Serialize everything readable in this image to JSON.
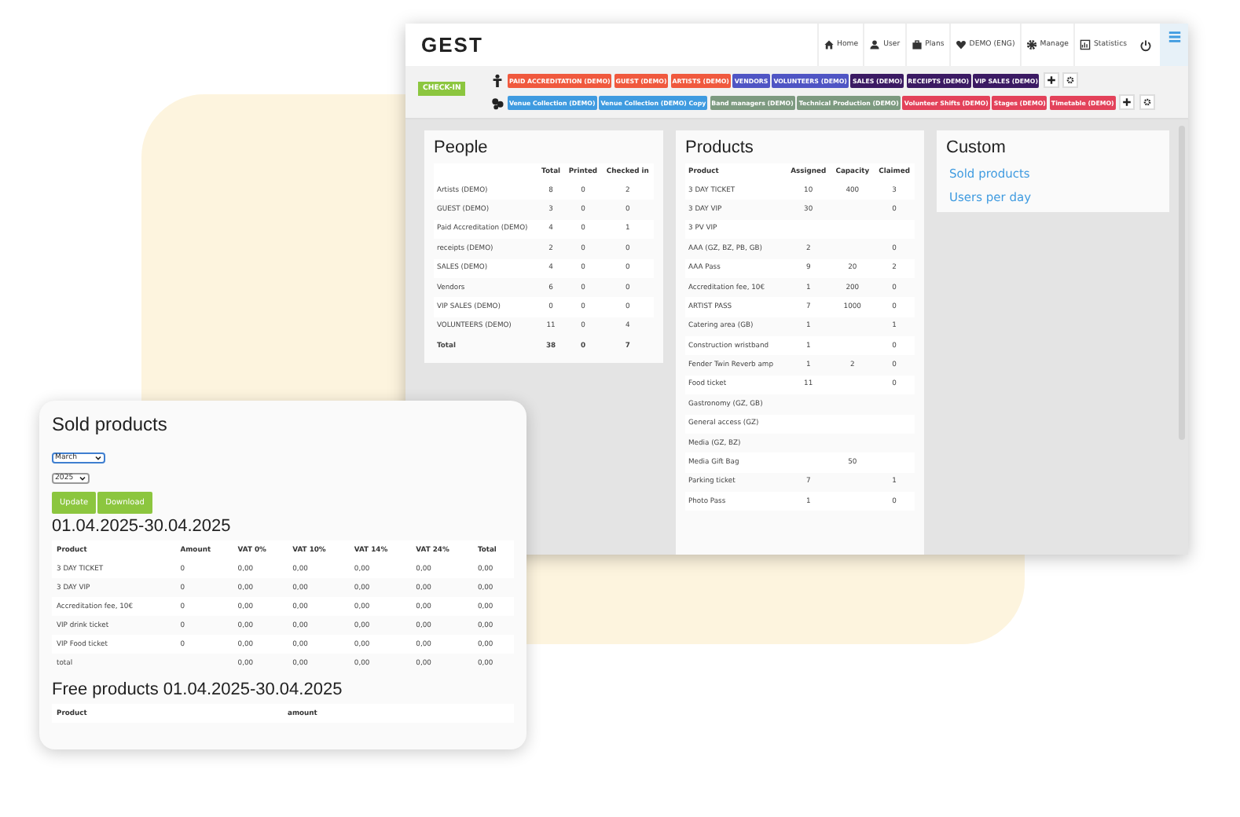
{
  "app": {
    "logo": "GEST",
    "nav": [
      {
        "label": "Home"
      },
      {
        "label": "User"
      },
      {
        "label": "Plans"
      },
      {
        "label": "DEMO (ENG)"
      },
      {
        "label": "Manage"
      },
      {
        "label": "Statistics"
      }
    ],
    "checkin": "CHECK-IN",
    "tag_rows": [
      {
        "tags": [
          {
            "label": "PAID ACCREDITATION (DEMO)",
            "color": "#f0593e"
          },
          {
            "label": "GUEST (DEMO)",
            "color": "#f0593e"
          },
          {
            "label": "ARTISTS (DEMO)",
            "color": "#f0593e"
          },
          {
            "label": "VENDORS",
            "color": "#4f55c4"
          },
          {
            "label": "VOLUNTEERS (DEMO)",
            "color": "#4f55c4"
          },
          {
            "label": "SALES (DEMO)",
            "color": "#3b1a63"
          },
          {
            "label": "RECEIPTS (DEMO)",
            "color": "#3b1a63"
          },
          {
            "label": "VIP SALES (DEMO)",
            "color": "#3b1a63"
          }
        ]
      },
      {
        "tags": [
          {
            "label": "Venue Collection (DEMO)",
            "color": "#3f9be0"
          },
          {
            "label": "Venue Collection (DEMO) Copy",
            "color": "#3f9be0"
          },
          {
            "label": "Band managers (DEMO)",
            "color": "#7d9a80"
          },
          {
            "label": "Technical Production (DEMO)",
            "color": "#7d9a80"
          },
          {
            "label": "Volunteer Shifts (DEMO)",
            "color": "#e3425a"
          },
          {
            "label": "Stages (DEMO)",
            "color": "#e3425a"
          },
          {
            "label": "Timetable (DEMO)",
            "color": "#e3425a"
          }
        ]
      }
    ],
    "people": {
      "title": "People",
      "columns": [
        "",
        "Total",
        "Printed",
        "Checked in"
      ],
      "rows": [
        [
          "Artists (DEMO)",
          "8",
          "0",
          "2"
        ],
        [
          "GUEST (DEMO)",
          "3",
          "0",
          "0"
        ],
        [
          "Paid Accreditation (DEMO)",
          "4",
          "0",
          "1"
        ],
        [
          "receipts (DEMO)",
          "2",
          "0",
          "0"
        ],
        [
          "SALES (DEMO)",
          "4",
          "0",
          "0"
        ],
        [
          "Vendors",
          "6",
          "0",
          "0"
        ],
        [
          "VIP SALES (DEMO)",
          "0",
          "0",
          "0"
        ],
        [
          "VOLUNTEERS (DEMO)",
          "11",
          "0",
          "4"
        ]
      ],
      "total": [
        "Total",
        "38",
        "0",
        "7"
      ]
    },
    "products": {
      "title": "Products",
      "columns": [
        "Product",
        "Assigned",
        "Capacity",
        "Claimed"
      ],
      "rows": [
        [
          "3 DAY TICKET",
          "10",
          "400",
          "3"
        ],
        [
          "3 DAY VIP",
          "30",
          "",
          "0"
        ],
        [
          "3 PV VIP",
          "",
          "",
          ""
        ],
        [
          "AAA (GZ, BZ, PB, GB)",
          "2",
          "",
          "0"
        ],
        [
          "AAA Pass",
          "9",
          "20",
          "2"
        ],
        [
          "Accreditation fee, 10€",
          "1",
          "200",
          "0"
        ],
        [
          "ARTIST PASS",
          "7",
          "1000",
          "0"
        ],
        [
          "Catering area (GB)",
          "1",
          "",
          "1"
        ],
        [
          "Construction wristband",
          "1",
          "",
          "0"
        ],
        [
          "Fender Twin Reverb amp",
          "1",
          "2",
          "0"
        ],
        [
          "Food ticket",
          "11",
          "",
          "0"
        ],
        [
          "Gastronomy (GZ, GB)",
          "",
          "",
          ""
        ],
        [
          "General access (GZ)",
          "",
          "",
          ""
        ],
        [
          "Media (GZ, BZ)",
          "",
          "",
          ""
        ],
        [
          "Media Gift Bag",
          "",
          "50",
          ""
        ],
        [
          "Parking ticket",
          "7",
          "",
          "1"
        ],
        [
          "Photo Pass",
          "1",
          "",
          "0"
        ]
      ]
    },
    "custom": {
      "title": "Custom",
      "links": [
        "Sold products",
        "Users per day"
      ]
    }
  },
  "sold": {
    "title": "Sold products",
    "month": "March",
    "year": "2025",
    "buttons": [
      "Update",
      "Download"
    ],
    "period": "01.04.2025-30.04.2025",
    "columns": [
      "Product",
      "Amount",
      "VAT 0%",
      "VAT 10%",
      "VAT 14%",
      "VAT 24%",
      "Total"
    ],
    "rows": [
      [
        "3 DAY TICKET",
        "0",
        "0,00",
        "0,00",
        "0,00",
        "0,00",
        "0,00"
      ],
      [
        "3 DAY VIP",
        "0",
        "0,00",
        "0,00",
        "0,00",
        "0,00",
        "0,00"
      ],
      [
        "Accreditation fee, 10€",
        "0",
        "0,00",
        "0,00",
        "0,00",
        "0,00",
        "0,00"
      ],
      [
        "VIP drink ticket",
        "0",
        "0,00",
        "0,00",
        "0,00",
        "0,00",
        "0,00"
      ],
      [
        "VIP Food ticket",
        "0",
        "0,00",
        "0,00",
        "0,00",
        "0,00",
        "0,00"
      ],
      [
        "total",
        "",
        "0,00",
        "0,00",
        "0,00",
        "0,00",
        "0,00"
      ]
    ],
    "free_title": "Free products 01.04.2025-30.04.2025",
    "free_columns": [
      "Product",
      "amount"
    ]
  }
}
